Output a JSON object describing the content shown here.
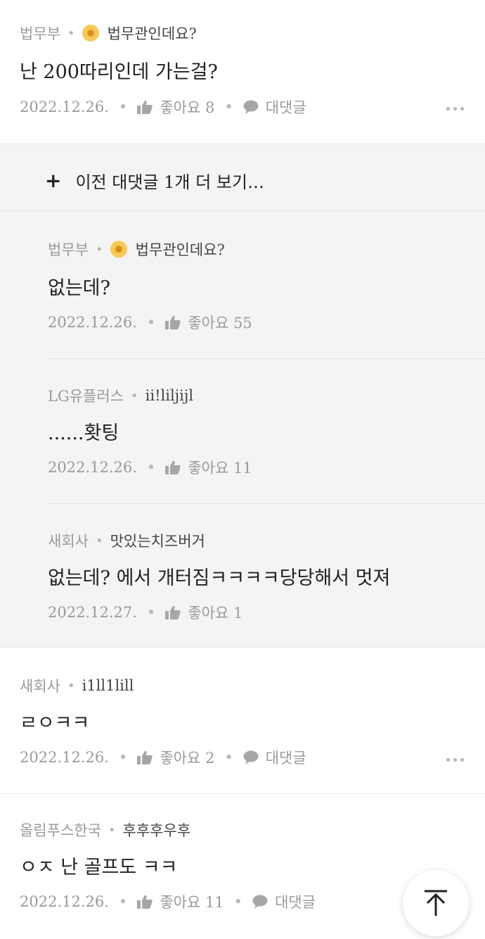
{
  "comments": [
    {
      "company": "법무부",
      "nickname": "법무관인데요?",
      "text": "난 200따리인데 가는걸?",
      "date": "2022.12.26.",
      "likes_label": "좋아요 8",
      "reply_label": "대댓글"
    },
    {
      "company": "새회사",
      "nickname": "i1ll1lill",
      "text": "ㄹㅇㅋㅋ",
      "date": "2022.12.26.",
      "likes_label": "좋아요 2",
      "reply_label": "대댓글"
    },
    {
      "company": "올림푸스한국",
      "nickname": "후후후우후",
      "text": "ㅇㅈ 난 골프도 ㅋㅋ",
      "date": "2022.12.26.",
      "likes_label": "좋아요 11",
      "reply_label": "대댓글"
    }
  ],
  "replies_section": {
    "load_more_label": "이전 대댓글 1개 더 보기…",
    "replies": [
      {
        "company": "법무부",
        "nickname": "법무관인데요?",
        "text": "없는데?",
        "date": "2022.12.26.",
        "likes_label": "좋아요 55"
      },
      {
        "company": "LG유플러스",
        "nickname": "ii!liljijl",
        "text": "......홧팅",
        "date": "2022.12.26.",
        "likes_label": "좋아요 11"
      },
      {
        "company": "새회사",
        "nickname": "맛있는치즈버거",
        "text": "없는데? 에서 개터짐ㅋㅋㅋㅋ당당해서 멋져",
        "date": "2022.12.27.",
        "likes_label": "좋아요 1"
      }
    ]
  },
  "icons": {
    "like": "thumbs-up-icon",
    "reply": "speech-bubble-icon",
    "more": "more-dots-icon",
    "badge": "verified-badge-icon",
    "scroll_top": "arrow-up-icon"
  },
  "colors": {
    "meta_gray": "#9a9a9a",
    "reply_bg": "#f4f4f4",
    "badge_gold": "#f2b43a"
  }
}
